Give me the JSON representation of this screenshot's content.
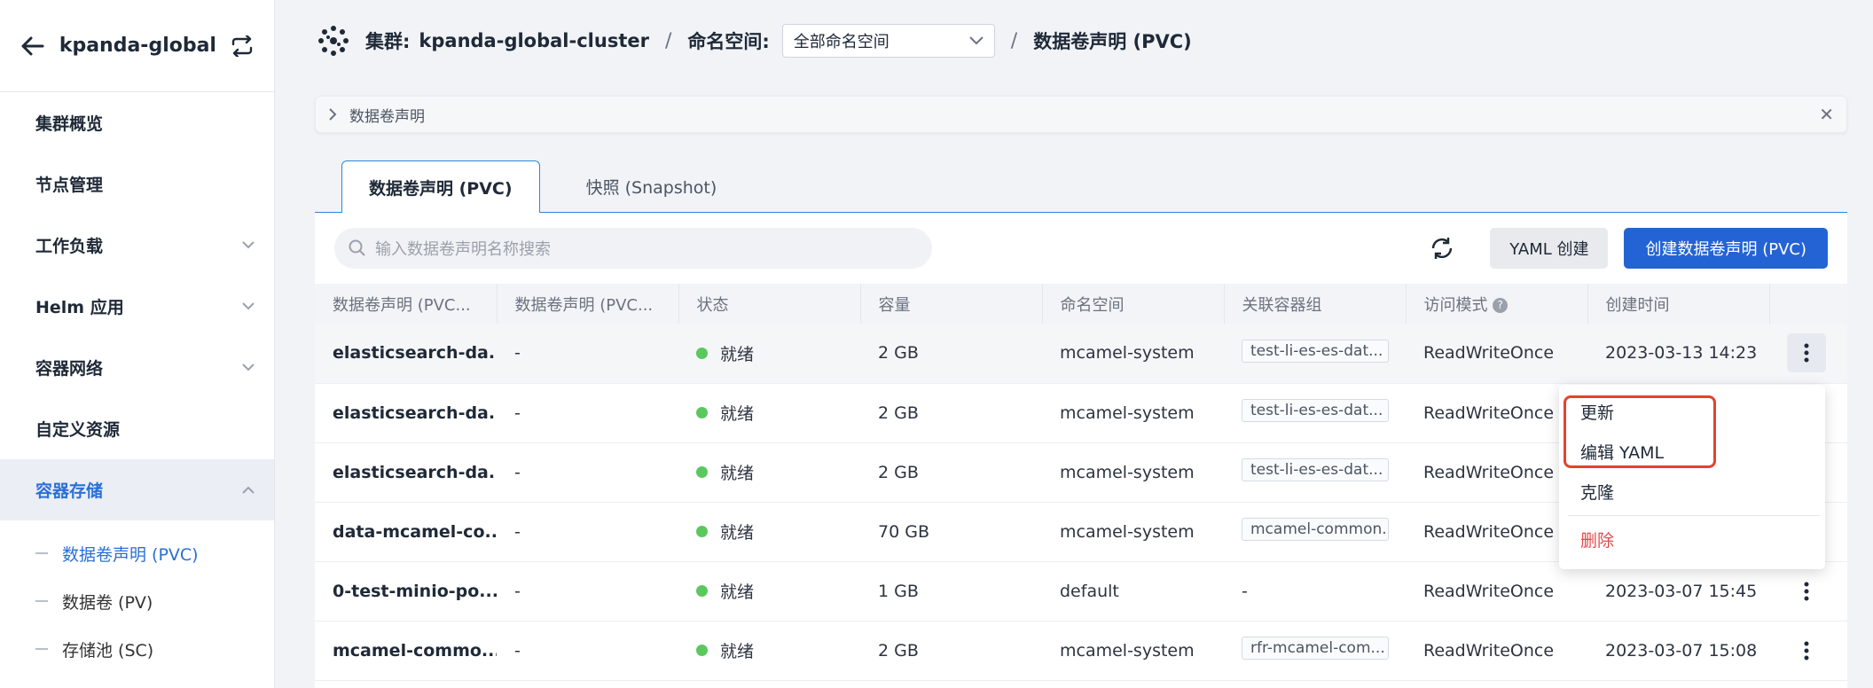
{
  "sidebar": {
    "title": "kpanda-global-...",
    "items": [
      {
        "label": "集群概览",
        "expandable": false
      },
      {
        "label": "节点管理",
        "expandable": false
      },
      {
        "label": "工作负载",
        "expandable": true
      },
      {
        "label": "Helm 应用",
        "expandable": true
      },
      {
        "label": "容器网络",
        "expandable": true
      },
      {
        "label": "自定义资源",
        "expandable": false
      },
      {
        "label": "容器存储",
        "expandable": true,
        "active": true
      }
    ],
    "subitems": [
      {
        "label": "数据卷声明 (PVC)",
        "active": true
      },
      {
        "label": "数据卷 (PV)"
      },
      {
        "label": "存储池 (SC)"
      }
    ]
  },
  "topbar": {
    "cluster_label": "集群:",
    "cluster_value": "kpanda-global-cluster",
    "separator": "/",
    "namespace_label": "命名空间:",
    "namespace_value": "全部命名空间",
    "page": "数据卷声明 (PVC)"
  },
  "infobar": {
    "text": "数据卷声明"
  },
  "tabs": [
    {
      "label": "数据卷声明 (PVC)",
      "active": true
    },
    {
      "label": "快照 (Snapshot)",
      "active": false
    }
  ],
  "toolbar": {
    "search_placeholder": "输入数据卷声明名称搜索",
    "yaml_create_label": "YAML 创建",
    "create_label": "创建数据卷声明 (PVC)"
  },
  "table": {
    "columns": [
      "数据卷声明 (PVC...",
      "数据卷声明 (PVC...",
      "状态",
      "容量",
      "命名空间",
      "关联容器组",
      "访问模式",
      "创建时间"
    ],
    "rows": [
      {
        "name": "elasticsearch-da...",
        "pv": "-",
        "status": "就绪",
        "capacity": "2 GB",
        "namespace": "mcamel-system",
        "pod": "test-li-es-es-dat...",
        "access": "ReadWriteOnce",
        "created": "2023-03-13 14:23"
      },
      {
        "name": "elasticsearch-da...",
        "pv": "-",
        "status": "就绪",
        "capacity": "2 GB",
        "namespace": "mcamel-system",
        "pod": "test-li-es-es-dat...",
        "access": "ReadWriteOnce",
        "created": ""
      },
      {
        "name": "elasticsearch-da...",
        "pv": "-",
        "status": "就绪",
        "capacity": "2 GB",
        "namespace": "mcamel-system",
        "pod": "test-li-es-es-dat...",
        "access": "ReadWriteOnce",
        "created": ""
      },
      {
        "name": "data-mcamel-co...",
        "pv": "-",
        "status": "就绪",
        "capacity": "70 GB",
        "namespace": "mcamel-system",
        "pod": "mcamel-common...",
        "access": "ReadWriteOnce",
        "created": ""
      },
      {
        "name": "0-test-minio-po...",
        "pv": "-",
        "status": "就绪",
        "capacity": "1 GB",
        "namespace": "default",
        "pod": "-",
        "access": "ReadWriteOnce",
        "created": "2023-03-07 15:45"
      },
      {
        "name": "mcamel-commo...",
        "pv": "-",
        "status": "就绪",
        "capacity": "2 GB",
        "namespace": "mcamel-system",
        "pod": "rfr-mcamel-com...",
        "access": "ReadWriteOnce",
        "created": "2023-03-07 15:08"
      }
    ]
  },
  "menu": {
    "items": [
      "更新",
      "编辑 YAML",
      "克隆"
    ],
    "danger_item": "删除"
  },
  "colors": {
    "accent": "#2463d4",
    "status_ok": "#5ac85f",
    "danger": "#e5484d",
    "highlight": "#e5422d"
  }
}
